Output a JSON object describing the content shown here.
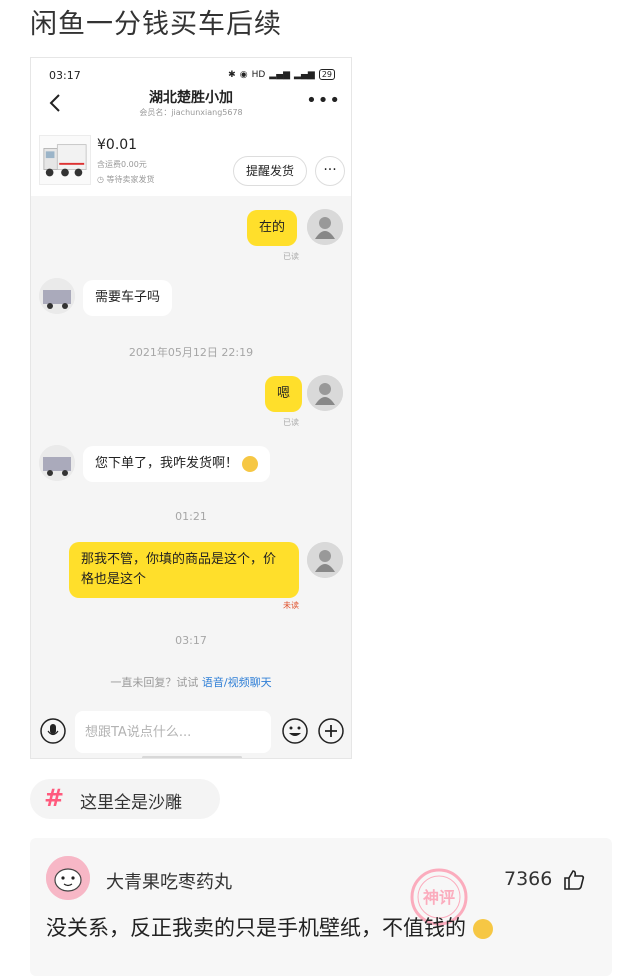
{
  "post": {
    "title": "闲鱼一分钱买车后续"
  },
  "phone": {
    "status_time": "03:17",
    "status_network": "HD",
    "status_battery": "29",
    "header": {
      "name": "湖北楚胜小加",
      "member_label": "会员名：jiachunxiang5678"
    },
    "item": {
      "price": "¥0.01",
      "shipping": "含运费0.00元",
      "status": "等待卖家发货",
      "remind_label": "提醒发货",
      "more_label": "···"
    },
    "messages": [
      {
        "side": "me",
        "text": "在的",
        "read": "已读"
      },
      {
        "side": "seller",
        "text": "需要车子吗"
      },
      {
        "type": "time",
        "text": "2021年05月12日 22:19"
      },
      {
        "side": "me",
        "text": "嗯",
        "read": "已读"
      },
      {
        "side": "seller",
        "text": "您下单了，我咋发货啊！"
      },
      {
        "type": "time",
        "text": "01:21"
      },
      {
        "side": "me",
        "text": "那我不管，你填的商品是这个，价格也是这个",
        "read": "未读"
      },
      {
        "type": "time",
        "text": "03:17"
      }
    ],
    "hint": {
      "prefix": "一直未回复？试试 ",
      "link": "语音/视频聊天"
    },
    "input": {
      "placeholder": "想跟TA说点什么..."
    }
  },
  "topic": {
    "text": "这里全是沙雕"
  },
  "comment": {
    "username": "大青果吃枣药丸",
    "likes": "7366",
    "text": "没关系，反正我卖的只是手机壁纸，不值钱的",
    "stamp_text": "神评"
  },
  "colors": {
    "bubble_me": "#ffdf2b",
    "hint_link": "#2f7fd6",
    "unread": "#e0502a",
    "topic_hash": "#ff5a7d"
  }
}
